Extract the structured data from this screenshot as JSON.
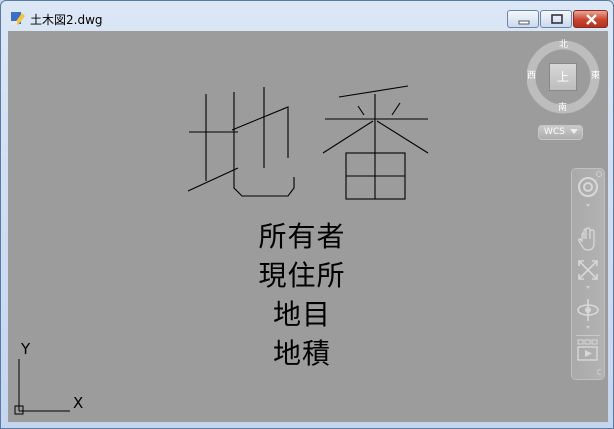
{
  "window": {
    "title": "土木図2.dwg"
  },
  "drawing": {
    "big_text": [
      "地",
      "番"
    ],
    "lines": [
      "所有者",
      "現住所",
      "地目",
      "地積"
    ]
  },
  "ucs": {
    "x_label": "X",
    "y_label": "Y"
  },
  "viewcube": {
    "north": "北",
    "south": "南",
    "east": "東",
    "west": "西",
    "top_face": "上"
  },
  "wcs": {
    "label": "WCS"
  },
  "navbar": {
    "items": [
      "steering-wheel",
      "pan",
      "zoom-extents",
      "orbit",
      "showmotion"
    ]
  },
  "colors": {
    "canvas_bg": "#9c9c9c",
    "ink": "#000000",
    "close_button": "#c9442e"
  }
}
